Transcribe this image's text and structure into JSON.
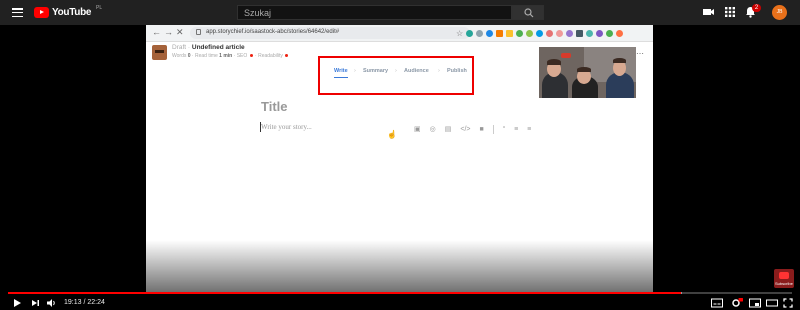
{
  "youtube": {
    "logo_text": "YouTube",
    "region": "PL",
    "search_placeholder": "Szukaj",
    "notifications_count": "2",
    "avatar_initials": "JB",
    "icons": [
      "menu-icon",
      "youtube-logo-icon",
      "search-icon",
      "create-video-icon",
      "apps-grid-icon",
      "bell-icon"
    ]
  },
  "browser": {
    "url": "app.storychief.io/saastock-abc/stories/64642/edit#",
    "icons": [
      "back-arrow-icon",
      "forward-arrow-icon",
      "close-x-icon",
      "lock-icon",
      "bookmark-star-icon"
    ]
  },
  "editor": {
    "status": "Draft",
    "title": "Undefined article",
    "meta": {
      "words_label": "Words",
      "words_value": "0",
      "read_time_label": "Read time",
      "read_time_value": "1 min",
      "seo_label": "SEO",
      "readability_label": "Readability"
    },
    "steps": [
      "Write",
      "Summary",
      "Audience",
      "Publish"
    ],
    "active_step": "Write",
    "title_placeholder": "Title",
    "story_placeholder": "Write your story...",
    "insert_tools": [
      "image-icon",
      "video-icon",
      "embed-icon",
      "code-icon",
      "gallery-icon",
      "quote-icon",
      "bulleted-list-icon",
      "numbered-list-icon"
    ]
  },
  "player": {
    "current_time": "19:13",
    "duration": "22:24",
    "time_display": "19:13 / 22:24",
    "progress": 0.858,
    "buffered": 0.86,
    "watermark_label": "Subscribe",
    "icons": [
      "play-icon",
      "next-icon",
      "volume-icon",
      "subtitles-icon",
      "settings-icon",
      "miniplayer-icon",
      "theater-icon",
      "fullscreen-icon"
    ]
  },
  "colors": {
    "youtube_red": "#ff0000",
    "header_bg": "#212121",
    "annotation_red": "#ee0000",
    "active_step": "#3b7ad9"
  }
}
